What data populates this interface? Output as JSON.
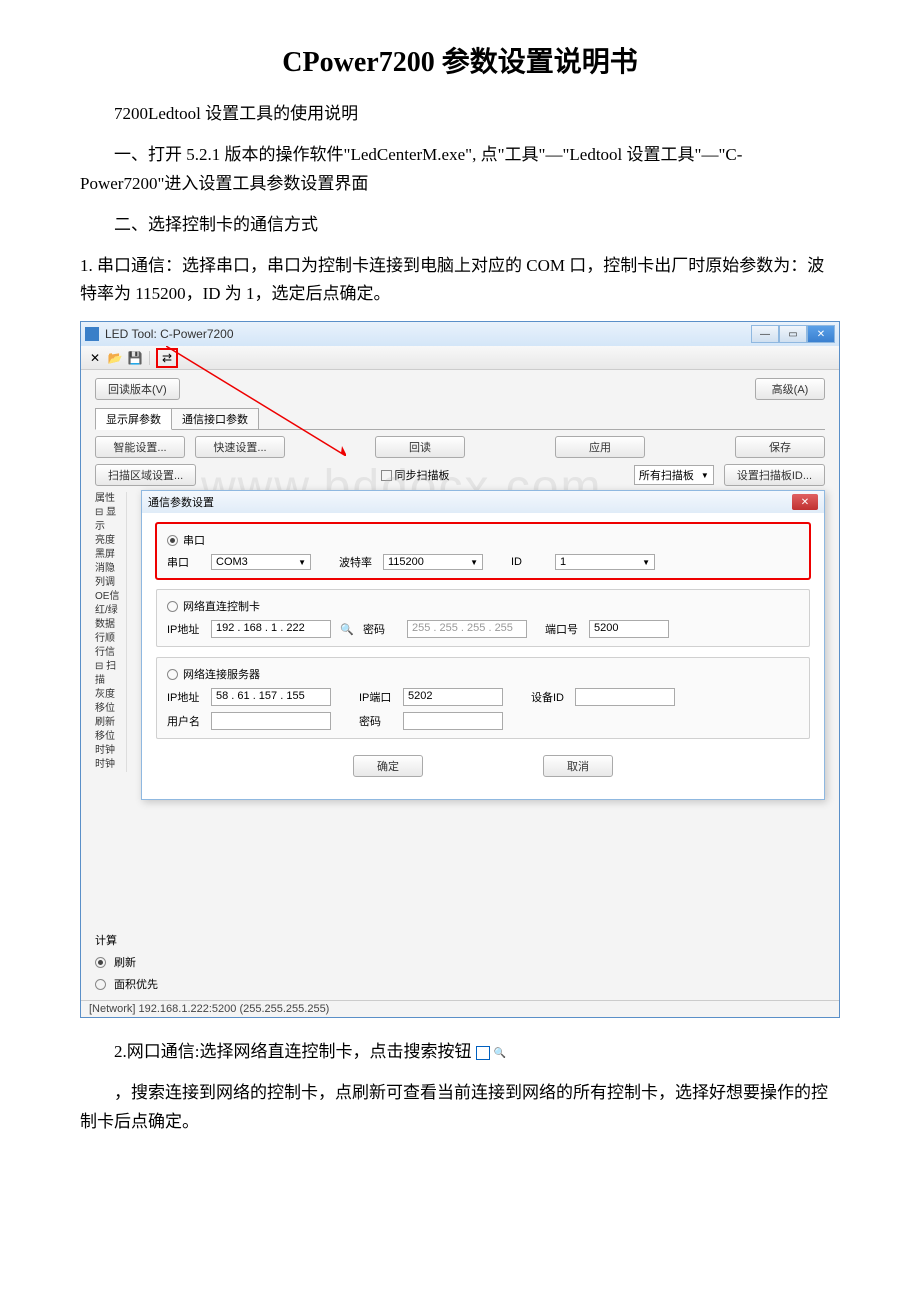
{
  "doc": {
    "title": "CPower7200 参数设置说明书",
    "p1": "7200Ledtool 设置工具的使用说明",
    "p2": "一、打开 5.2.1 版本的操作软件\"LedCenterM.exe\", 点\"工具\"—\"Ledtool 设置工具\"—\"C-Power7200\"进入设置工具参数设置界面",
    "p3": "二、选择控制卡的通信方式",
    "p4": "1. 串口通信：选择串口，串口为控制卡连接到电脑上对应的 COM 口，控制卡出厂时原始参数为：波特率为 115200，ID 为 1，选定后点确定。",
    "p5a": "2.网口通信:选择网络直连控制卡，点击搜索按钮",
    "p5b": "，搜索连接到网络的控制卡，点刷新可查看当前连接到网络的所有控制卡，选择好想要操作的控制卡后点确定。"
  },
  "app": {
    "title": "LED Tool: C-Power7200",
    "watermark": "www.bddocx.com",
    "toolbar": {
      "close_x": "✕",
      "open": "📂",
      "save": "💾",
      "comm": "⇄"
    },
    "buttons": {
      "readback_version": "回读版本(V)",
      "advanced": "高级(A)",
      "smart_setup": "智能设置...",
      "quick_setup": "快速设置...",
      "readback": "回读",
      "apply": "应用",
      "save": "保存",
      "scan_area": "扫描区域设置...",
      "sync_scan": "同步扫描板",
      "all_scan": "所有扫描板",
      "scan_id": "设置扫描板ID..."
    },
    "tabs": {
      "display": "显示屏参数",
      "comm": "通信接口参数"
    },
    "prop": {
      "title": "属性",
      "items": [
        "亮度",
        "黑屏",
        "消隐",
        "列调",
        "OE信",
        "红/绿",
        "数据",
        "行顺",
        "行信",
        "",
        "灰度",
        "移位",
        "刷新",
        "移位",
        "时钟",
        "时钟"
      ],
      "tree1": "⊟ 显示",
      "tree2": "⊟ 扫描",
      "calc": "计算",
      "refresh_pri": "刷新",
      "area_pri": "面积优先"
    },
    "status": "[Network] 192.168.1.222:5200 (255.255.255.255)"
  },
  "dlg": {
    "title": "通信参数设置",
    "g1": {
      "radio": "串口",
      "port_lbl": "串口",
      "port_val": "COM3",
      "baud_lbl": "波特率",
      "baud_val": "115200",
      "id_lbl": "ID",
      "id_val": "1"
    },
    "g2": {
      "radio": "网络直连控制卡",
      "ip_lbl": "IP地址",
      "ip_val": "192 . 168 .  1  . 222",
      "pwd_lbl": "密码",
      "mask_val": "255 . 255 . 255 . 255",
      "port_lbl": "端口号",
      "port_val": "5200"
    },
    "g3": {
      "radio": "网络连接服务器",
      "ip_lbl": "IP地址",
      "ip_val": "58 .  61 . 157 . 155",
      "ipport_lbl": "IP端口",
      "ipport_val": "5202",
      "devid_lbl": "设备ID",
      "user_lbl": "用户名",
      "pwd_lbl": "密码"
    },
    "ok": "确定",
    "cancel": "取消"
  }
}
